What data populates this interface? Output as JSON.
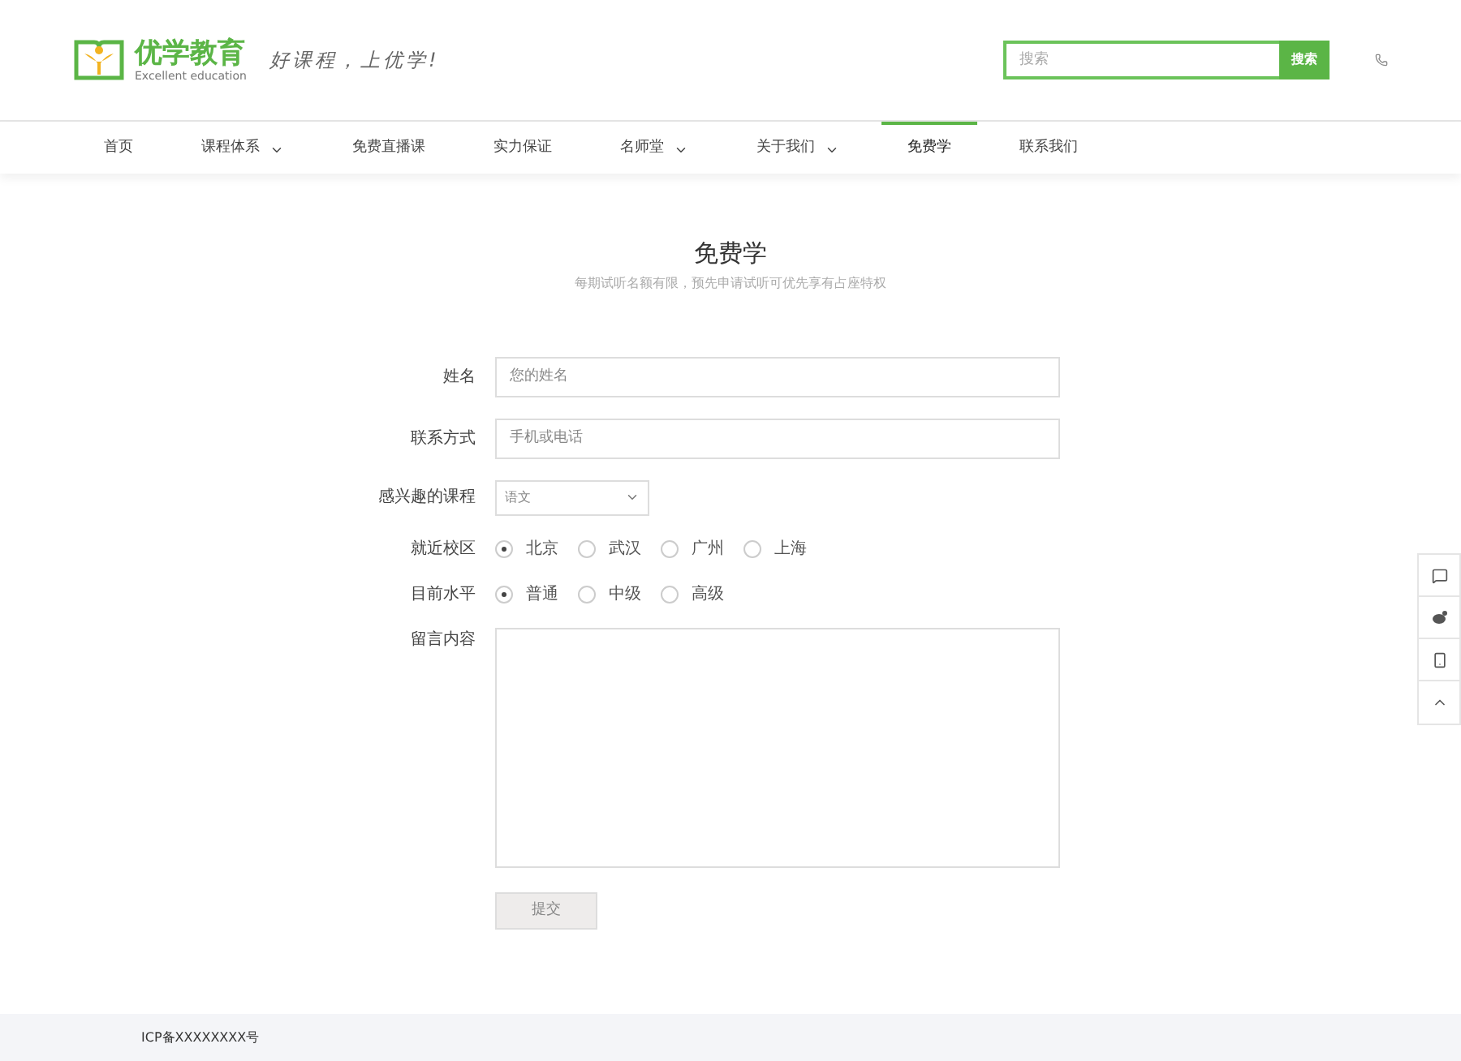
{
  "header": {
    "logo_title": "优学教育",
    "logo_subtitle": "Excellent education",
    "slogan": "好课程，上优学!",
    "search": {
      "placeholder": "搜索",
      "button": "搜索"
    }
  },
  "nav": [
    {
      "label": "首页",
      "selected": false,
      "dropdown": false
    },
    {
      "label": "课程体系",
      "selected": false,
      "dropdown": true
    },
    {
      "label": "免费直播课",
      "selected": false,
      "dropdown": false
    },
    {
      "label": "实力保证",
      "selected": false,
      "dropdown": false
    },
    {
      "label": "名师堂",
      "selected": false,
      "dropdown": true
    },
    {
      "label": "关于我们",
      "selected": false,
      "dropdown": true
    },
    {
      "label": "免费学",
      "selected": true,
      "dropdown": false
    },
    {
      "label": "联系我们",
      "selected": false,
      "dropdown": false
    }
  ],
  "page": {
    "title": "免费学",
    "subtitle": "每期试听名额有限，预先申请试听可优先享有占座特权"
  },
  "form": {
    "name": {
      "label": "姓名",
      "placeholder": "您的姓名"
    },
    "contact": {
      "label": "联系方式",
      "placeholder": "手机或电话"
    },
    "course": {
      "label": "感兴趣的课程",
      "value": "语文"
    },
    "campus": {
      "label": "就近校区",
      "options": [
        {
          "label": "北京",
          "selected": true
        },
        {
          "label": "武汉",
          "selected": false
        },
        {
          "label": "广州",
          "selected": false
        },
        {
          "label": "上海",
          "selected": false
        }
      ]
    },
    "level": {
      "label": "目前水平",
      "options": [
        {
          "label": "普通",
          "selected": true
        },
        {
          "label": "中级",
          "selected": false
        },
        {
          "label": "高级",
          "selected": false
        }
      ]
    },
    "message": {
      "label": "留言内容"
    },
    "submit": "提交"
  },
  "footer": {
    "text": "ICP备XXXXXXXX号"
  }
}
